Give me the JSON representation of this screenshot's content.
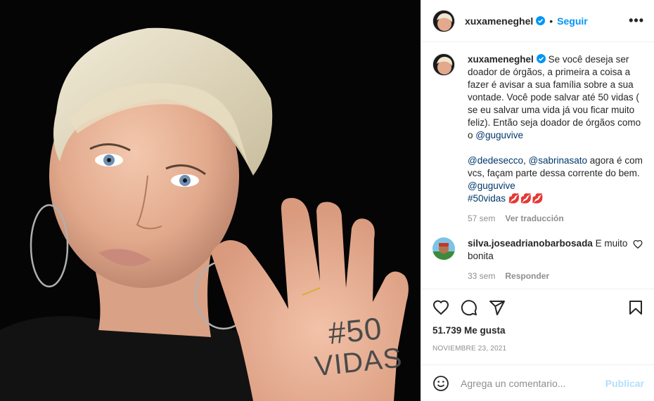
{
  "header": {
    "username": "xuxameneghel",
    "separator": "•",
    "follow_label": "Seguir",
    "more_label": "•••"
  },
  "photo": {
    "hand_line1": "#50",
    "hand_line2": "VIDAS"
  },
  "caption": {
    "username": "xuxameneghel",
    "text_part1": "Se você deseja ser doador de órgãos, a primeira a coisa a fazer é avisar a sua família sobre a sua vontade. Você pode salvar até 50 vidas ( se eu salvar uma vida já vou ficar muito feliz). Então seja doador de órgãos como o ",
    "mention1": "@guguvive",
    "mention2": "@dedesecco",
    "sep1": ", ",
    "mention3": "@sabrinasato",
    "text_part2": " agora é com vcs, façam parte dessa corrente do bem. ",
    "mention4": "@guguvive",
    "hashtag": "#50vidas",
    "emojis": "💋💋💋",
    "time": "57 sem",
    "translate_label": "Ver traducción"
  },
  "comment": {
    "username": "silva.joseadrianobarbosada",
    "text": "E muito bonita",
    "time": "33 sem",
    "reply_label": "Responder"
  },
  "stats": {
    "likes": "51.739 Me gusta",
    "date": "NOVIEMBRE 23, 2021"
  },
  "add_comment": {
    "placeholder": "Agrega un comentario...",
    "publish_label": "Publicar"
  },
  "colors": {
    "link": "#0095f6",
    "mention": "#00376b",
    "muted": "#8e8e8e",
    "publish_disabled": "#b2dffc"
  }
}
